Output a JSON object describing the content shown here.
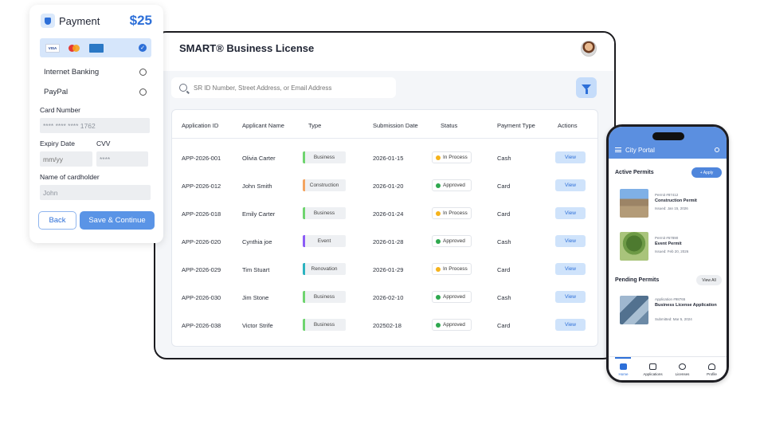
{
  "tablet": {
    "title": "SMART® Business License",
    "search_placeholder": "SR ID Number, Street Address, or Email Address",
    "columns": [
      "Application ID",
      "Applicant Name",
      "Type",
      "Submission Date",
      "Status",
      "Payment Type",
      "Actions"
    ],
    "rows": [
      {
        "id": "APP-2026-001",
        "name": "Olivia Carter",
        "type": "Business",
        "type_color": "#6fd46f",
        "date": "2026-01-15",
        "status": "In Process",
        "status_color": "#f5b31c",
        "payment": "Cash",
        "action": "View"
      },
      {
        "id": "APP-2026-012",
        "name": "John Smith",
        "type": "Construction",
        "type_color": "#f4a460",
        "date": "2026-01-20",
        "status": "Approved",
        "status_color": "#2fa84f",
        "payment": "Card",
        "action": "View"
      },
      {
        "id": "APP-2026-018",
        "name": "Emily Carter",
        "type": "Business",
        "type_color": "#6fd46f",
        "date": "2026-01-24",
        "status": "In Process",
        "status_color": "#f5b31c",
        "payment": "Card",
        "action": "View"
      },
      {
        "id": "APP-2026-020",
        "name": "Cynthia joe",
        "type": "Event",
        "type_color": "#8b5cf6",
        "date": "2026-01-28",
        "status": "Approved",
        "status_color": "#2fa84f",
        "payment": "Cash",
        "action": "View"
      },
      {
        "id": "APP-2026-029",
        "name": "Tim Stuart",
        "type": "Renovation",
        "type_color": "#2bb3c0",
        "date": "2026-01-29",
        "status": "In Process",
        "status_color": "#f5b31c",
        "payment": "Card",
        "action": "View"
      },
      {
        "id": "APP-2026-030",
        "name": "Jim Stone",
        "type": "Business",
        "type_color": "#6fd46f",
        "date": "2026-02-10",
        "status": "Approved",
        "status_color": "#2fa84f",
        "payment": "Cash",
        "action": "View"
      },
      {
        "id": "APP-2026-038",
        "name": "Victor Strife",
        "type": "Business",
        "type_color": "#6fd46f",
        "date": "202502-18",
        "status": "Approved",
        "status_color": "#2fa84f",
        "payment": "Card",
        "action": "View"
      }
    ]
  },
  "payment": {
    "title": "Payment",
    "amount": "$25",
    "card_brands": [
      "VISA",
      "",
      ""
    ],
    "options": [
      "Internet Banking",
      "PayPal"
    ],
    "card_number_label": "Card Number",
    "card_number_value": "**** **** **** 1762",
    "expiry_label": "Expiry Date",
    "expiry_placeholder": "mm/yy",
    "cvv_label": "CVV",
    "cvv_value": "****",
    "holder_label": "Name of cardholder",
    "holder_value": "John",
    "back_label": "Back",
    "save_label": "Save & Continue",
    "accent": "#2d6fd8"
  },
  "phone": {
    "title": "City Portal",
    "active_title": "Active Permits",
    "apply_label": "+ Apply",
    "active_permits": [
      {
        "number": "Permit #87412",
        "name": "Construction Permit",
        "issued": "Issued: Jan 15, 2026"
      },
      {
        "number": "Permit #67890",
        "name": "Event Permit",
        "issued": "Issued: Feb 20, 2026"
      }
    ],
    "pending_title": "Pending Permits",
    "view_all_label": "View All",
    "pending_permits": [
      {
        "number": "Application #98765",
        "name": "Business License Application",
        "submitted": "Submitted: Mar 5, 2024"
      }
    ],
    "tabs": [
      "Home",
      "Applications",
      "Licenses",
      "Profile"
    ]
  }
}
